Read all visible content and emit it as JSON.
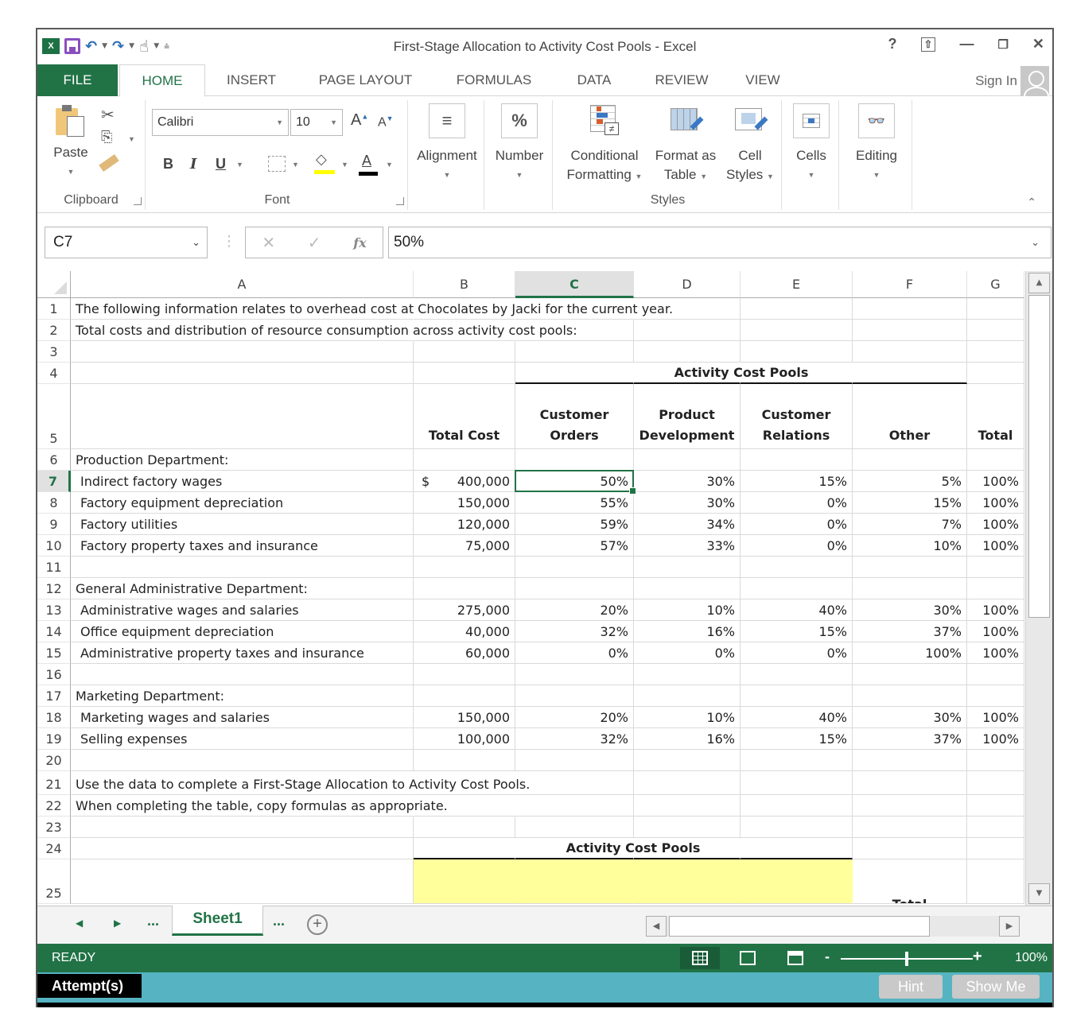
{
  "window": {
    "title": "First-Stage Allocation to Activity Cost Pools - Excel",
    "controls": [
      "help",
      "ribbon-display",
      "minimize",
      "restore",
      "close"
    ]
  },
  "qat": {
    "logo": "X",
    "icons": [
      "excel-logo",
      "save-icon",
      "undo-icon",
      "redo-icon",
      "touch-mode-icon",
      "customize-qat-icon"
    ]
  },
  "tabs": [
    {
      "label": "FILE"
    },
    {
      "label": "HOME",
      "active": true
    },
    {
      "label": "INSERT"
    },
    {
      "label": "PAGE LAYOUT"
    },
    {
      "label": "FORMULAS"
    },
    {
      "label": "DATA"
    },
    {
      "label": "REVIEW"
    },
    {
      "label": "VIEW"
    }
  ],
  "signin": "Sign In",
  "ribbon": {
    "clipboard": {
      "paste": "Paste",
      "label": "Clipboard"
    },
    "font": {
      "name": "Calibri",
      "size": "10",
      "bold": "B",
      "italic": "I",
      "underline": "U",
      "font_color_glyph": "A",
      "label": "Font",
      "highlight_color": "#ffff00",
      "font_color": "#000000"
    },
    "alignment": {
      "label": "Alignment"
    },
    "number": {
      "label": "Number",
      "glyph": "%"
    },
    "styles": {
      "cond_line1": "Conditional",
      "cond_line2": "Formatting",
      "fmt_line1": "Format as",
      "fmt_line2": "Table",
      "cell_line1": "Cell",
      "cell_line2": "Styles",
      "label": "Styles"
    },
    "cells": {
      "label": "Cells"
    },
    "editing": {
      "label": "Editing"
    }
  },
  "formula_bar": {
    "name_box": "C7",
    "cancel": "✕",
    "enter": "✓",
    "fx": "fx",
    "value": "50%"
  },
  "columns": [
    "A",
    "B",
    "C",
    "D",
    "E",
    "F",
    "G"
  ],
  "selected_column": "C",
  "selected_row": "7",
  "rows": {
    "r1": "The following information relates to overhead cost at Chocolates by Jacki for the current year.",
    "r2": "Total costs and distribution of resource consumption across activity cost pools:",
    "r4_header": "Activity Cost Pools",
    "r5": {
      "total_cost": "Total Cost",
      "c_1": "Customer",
      "c_2": "Orders",
      "d_1": "Product",
      "d_2": "Development",
      "e_1": "Customer",
      "e_2": "Relations",
      "f": "Other",
      "g": "Total"
    },
    "r6": "Production Department:",
    "r12": "General Administrative Department:",
    "r17": "Marketing Department:",
    "r21": "Use the data to complete a First-Stage Allocation to Activity Cost Pools.",
    "r22": "When completing the table, copy formulas as appropriate.",
    "r24_header": "Activity Cost Pools",
    "r25_partial": "Total"
  },
  "cost_items": [
    {
      "row": "7",
      "label": "Indirect factory wages",
      "currency": "$",
      "total": "400,000",
      "customer_orders": "50%",
      "product_development": "30%",
      "customer_relations": "15%",
      "other": "5%",
      "total_pct": "100%"
    },
    {
      "row": "8",
      "label": "Factory equipment depreciation",
      "currency": "",
      "total": "150,000",
      "customer_orders": "55%",
      "product_development": "30%",
      "customer_relations": "0%",
      "other": "15%",
      "total_pct": "100%"
    },
    {
      "row": "9",
      "label": "Factory utilities",
      "currency": "",
      "total": "120,000",
      "customer_orders": "59%",
      "product_development": "34%",
      "customer_relations": "0%",
      "other": "7%",
      "total_pct": "100%"
    },
    {
      "row": "10",
      "label": "Factory property taxes and insurance",
      "currency": "",
      "total": "75,000",
      "customer_orders": "57%",
      "product_development": "33%",
      "customer_relations": "0%",
      "other": "10%",
      "total_pct": "100%"
    },
    {
      "row": "13",
      "label": "Administrative wages and salaries",
      "currency": "",
      "total": "275,000",
      "customer_orders": "20%",
      "product_development": "10%",
      "customer_relations": "40%",
      "other": "30%",
      "total_pct": "100%"
    },
    {
      "row": "14",
      "label": "Office equipment depreciation",
      "currency": "",
      "total": "40,000",
      "customer_orders": "32%",
      "product_development": "16%",
      "customer_relations": "15%",
      "other": "37%",
      "total_pct": "100%"
    },
    {
      "row": "15",
      "label": "Administrative property taxes and insurance",
      "currency": "",
      "total": "60,000",
      "customer_orders": "0%",
      "product_development": "0%",
      "customer_relations": "0%",
      "other": "100%",
      "total_pct": "100%"
    },
    {
      "row": "18",
      "label": "Marketing wages and salaries",
      "currency": "",
      "total": "150,000",
      "customer_orders": "20%",
      "product_development": "10%",
      "customer_relations": "40%",
      "other": "30%",
      "total_pct": "100%"
    },
    {
      "row": "19",
      "label": "Selling expenses",
      "currency": "",
      "total": "100,000",
      "customer_orders": "32%",
      "product_development": "16%",
      "customer_relations": "15%",
      "other": "37%",
      "total_pct": "100%"
    }
  ],
  "row_numbers": [
    "1",
    "2",
    "3",
    "4",
    "5",
    "6",
    "7",
    "8",
    "9",
    "10",
    "11",
    "12",
    "13",
    "14",
    "15",
    "16",
    "17",
    "18",
    "19",
    "20",
    "21",
    "22",
    "23",
    "24",
    "25"
  ],
  "sheet_tabs": {
    "active": "Sheet1",
    "ellipsis": "...",
    "add": "+"
  },
  "status": {
    "mode": "READY",
    "zoom": "100%",
    "zoom_level": 1.0
  },
  "attempts": {
    "label": "Attempt(s)",
    "hint": "Hint",
    "show_me": "Show Me"
  },
  "colors": {
    "excel_green": "#217346",
    "yellow_fill": "#ffff9c",
    "attempt_bar": "#56b3c1"
  }
}
